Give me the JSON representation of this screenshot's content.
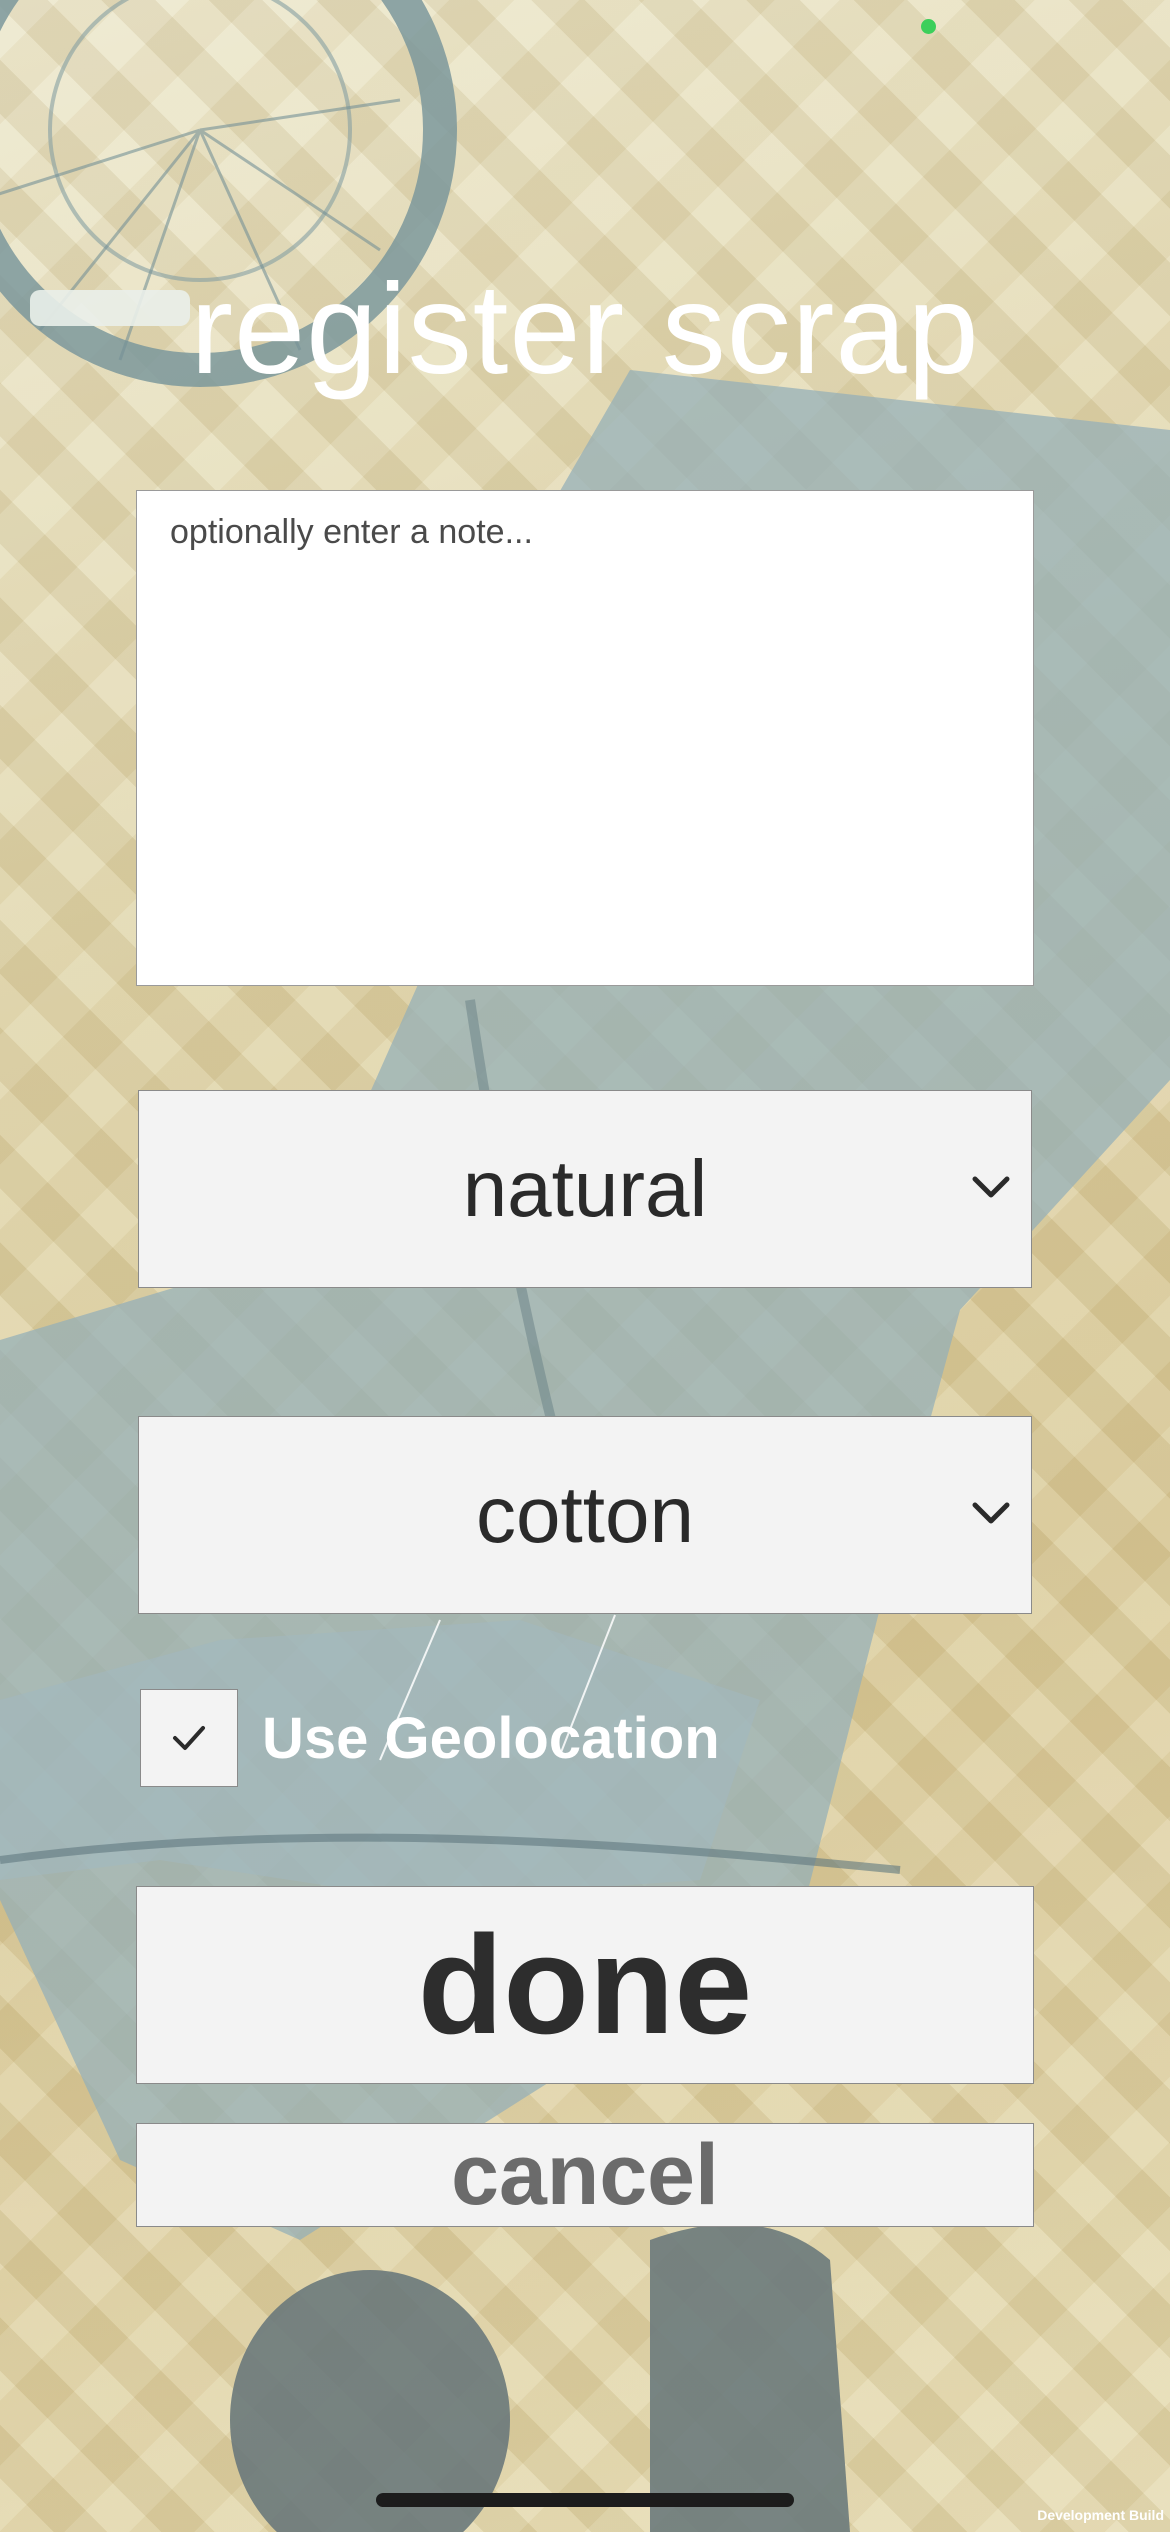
{
  "app": {
    "title": "register scrap"
  },
  "note": {
    "placeholder": "optionally enter a note...",
    "value": ""
  },
  "dropdowns": {
    "type": {
      "selected": "natural"
    },
    "material": {
      "selected": "cotton"
    }
  },
  "geolocation": {
    "label": "Use Geolocation",
    "checked": true
  },
  "actions": {
    "done_label": "done",
    "cancel_label": "cancel"
  },
  "footer": {
    "build_label": "Development Build"
  },
  "icons": {
    "dropdown_indicator": "chevron-down-icon",
    "checkbox_mark": "checkmark-icon"
  },
  "colors": {
    "status_dot": "#3ccf5b",
    "control_bg": "#f3f3f3",
    "title_text": "#ffffff"
  }
}
